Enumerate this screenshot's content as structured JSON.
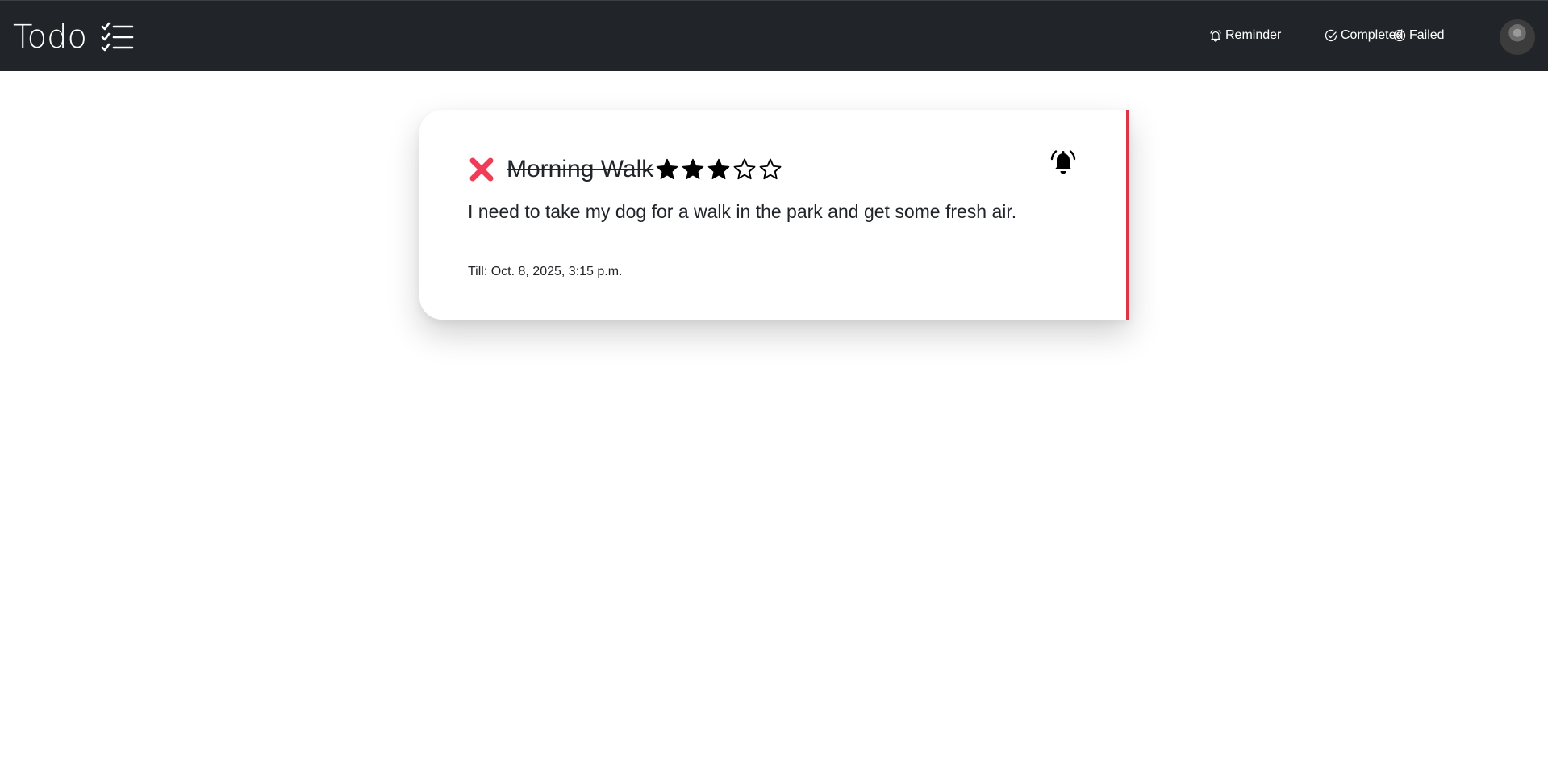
{
  "navbar": {
    "brand": "Todo",
    "brand_icon": "checklist-icon",
    "links": [
      {
        "label": "Reminder",
        "icon": "bell-outline-icon"
      },
      {
        "label": "Completed",
        "icon": "check-circle-icon"
      },
      {
        "label": "Failed",
        "icon": "x-circle-icon"
      }
    ],
    "avatar": "user-avatar"
  },
  "colors": {
    "navbar_bg": "#212529",
    "failed_accent": "#dc3545",
    "fail_icon": "#f23c57"
  },
  "todo": {
    "status_icon": "x-icon",
    "title": "Morning Walk",
    "rating": 3,
    "rating_max": 5,
    "description": "I need to take my dog for a walk in the park and get some fresh air.",
    "due": "Till: Oct. 8, 2025, 3:15 p.m.",
    "reminder_icon": "bell-ringing-icon"
  }
}
